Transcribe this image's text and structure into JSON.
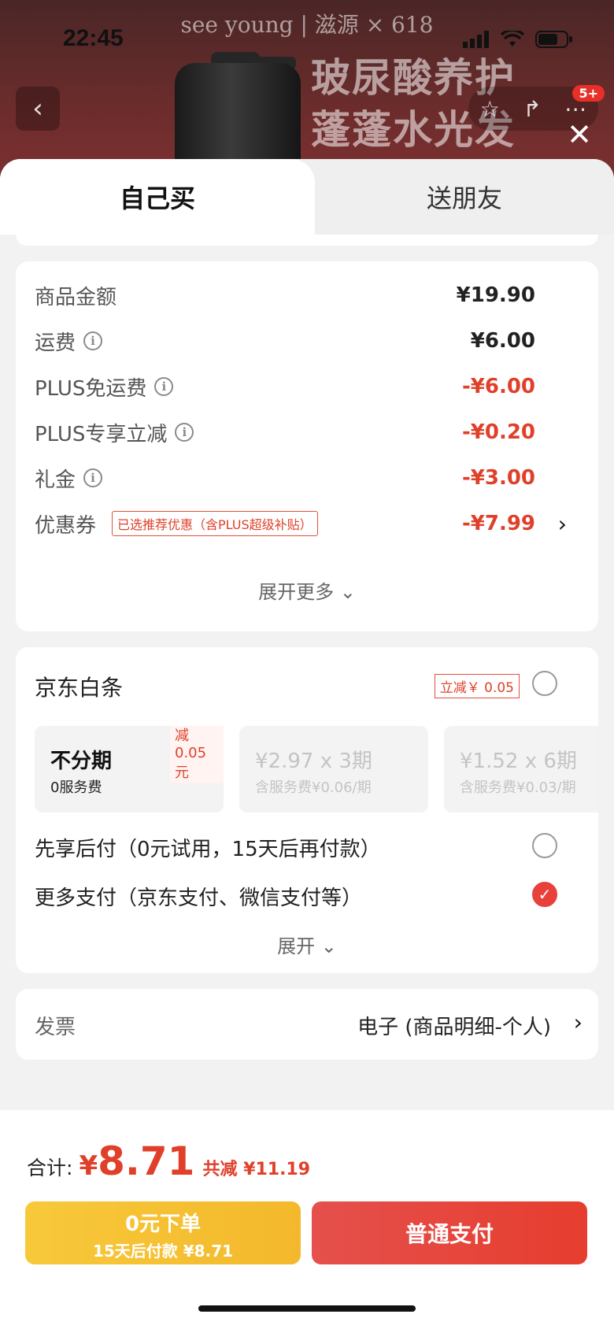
{
  "status_bar": {
    "time": "22:45"
  },
  "banner": {
    "brand": "see young | 滋源 × 618",
    "slogan_line1": "玻尿酸养护",
    "slogan_line2": "蓬蓬水光发",
    "notif_badge": "5+"
  },
  "tabs": {
    "self": "自己买",
    "gift": "送朋友"
  },
  "fees": [
    {
      "label": "商品金额",
      "info": false,
      "value": "¥19.90",
      "red": false
    },
    {
      "label": "运费",
      "info": true,
      "value": "¥6.00",
      "red": false
    },
    {
      "label": "PLUS免运费",
      "info": true,
      "value": "-¥6.00",
      "red": true
    },
    {
      "label": "PLUS专享立减",
      "info": true,
      "value": "-¥0.20",
      "red": true
    },
    {
      "label": "礼金",
      "info": true,
      "value": "-¥3.00",
      "red": true
    },
    {
      "label": "优惠券",
      "info": false,
      "value": "-¥7.99",
      "red": true
    }
  ],
  "coupon_tag": "已选推荐优惠（含PLUS超级补贴）",
  "expand_more": "展开更多",
  "payment": {
    "baitiao_title": "京东白条",
    "baitiao_discount": "立减￥ 0.05",
    "plans": [
      {
        "title": "不分期",
        "sub": "0服务费",
        "reduce": "减0.05元"
      },
      {
        "title": "¥2.97 x 3期",
        "sub": "含服务费¥0.06/期"
      },
      {
        "title": "¥1.52 x 6期",
        "sub": "含服务费¥0.03/期"
      }
    ],
    "bnpl_option": "先享后付（0元试用，15天后再付款）",
    "more_option": "更多支付（京东支付、微信支付等）",
    "expand": "展开"
  },
  "invoice": {
    "label": "发票",
    "value": "电子 (商品明细-个人)"
  },
  "summary": {
    "total_label": "合计:",
    "currency": "¥",
    "total": "8.71",
    "saved": "共减 ¥11.19"
  },
  "buttons": {
    "bnpl_line1": "0元下单",
    "bnpl_line2": "15天后付款 ¥8.71",
    "pay": "普通支付"
  },
  "colors": {
    "accent_red": "#e0402a",
    "bnpl_yellow": "#f4b82c",
    "pay_red": "#e63d2e"
  }
}
